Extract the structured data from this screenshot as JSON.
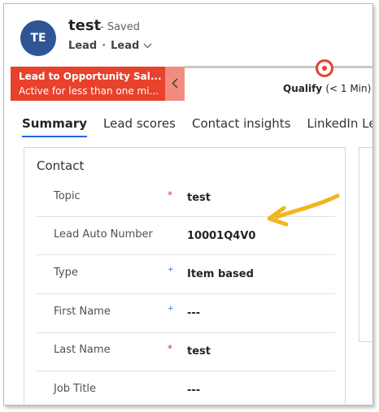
{
  "header": {
    "avatar_initials": "TE",
    "record_title": "test",
    "saved_status": "- Saved",
    "entity": "Lead",
    "form_selector": "Lead"
  },
  "process": {
    "active_stage_name": "Lead to Opportunity Sal...",
    "active_stage_time": "Active for less than one mi...",
    "qualify_label": "Qualify",
    "qualify_duration": "(< 1 Min)"
  },
  "tabs": [
    "Summary",
    "Lead scores",
    "Contact insights",
    "LinkedIn Lead In"
  ],
  "contact": {
    "section_title": "Contact",
    "fields": [
      {
        "label": "Topic",
        "value": "test",
        "required": "required"
      },
      {
        "label": "Lead Auto Number",
        "value": "10001Q4V0",
        "required": "none"
      },
      {
        "label": "Type",
        "value": "Item based",
        "required": "recommended"
      },
      {
        "label": "First Name",
        "value": "---",
        "required": "recommended"
      },
      {
        "label": "Last Name",
        "value": "test",
        "required": "required"
      },
      {
        "label": "Job Title",
        "value": "---",
        "required": "none"
      }
    ]
  },
  "colors": {
    "avatar": "#2f5597",
    "stage_active": "#e8412c",
    "tab_underline": "#2266e3",
    "annotation_arrow": "#f2b51f"
  }
}
